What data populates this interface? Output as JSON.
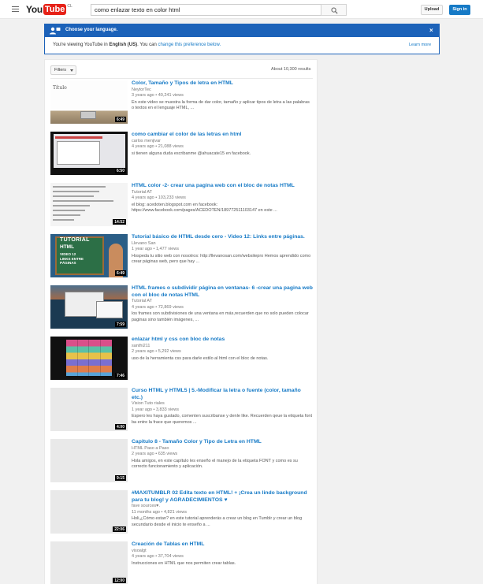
{
  "header": {
    "logo_you": "You",
    "logo_tube": "Tube",
    "logo_region": "CL",
    "search_value": "como enlazar texto en color html",
    "upload_label": "Upload",
    "signin_label": "Sign in"
  },
  "language_banner": {
    "title": "Choose your language.",
    "text_prefix": "You're viewing YouTube in ",
    "language": "English (US)",
    "text_middle": ". You can ",
    "change_link": "change this preference below.",
    "learn_more": "Learn more",
    "close": "×"
  },
  "results": {
    "filters_label": "Filters",
    "count_text": "About 10,300 results",
    "items": [
      {
        "title": "Color, Tamaño y Tipos de letra en HTML",
        "channel": "NeytorTec",
        "meta": "3 years ago  •  40,241 views",
        "description": "En este video se muestra la forma de dar color, tamaño y aplicar tipos de letra a las palabras o textos en el lenguaje HTML, ...",
        "duration": "6:49",
        "thumb_label": "Título"
      },
      {
        "title": "como cambiar el color de las letras en html",
        "channel": "carlos menjivar",
        "meta": "4 years ago  •  21,088 views",
        "description": "si tienen alguna duda escribanme @ahuacate15 en facebook.",
        "duration": "6:50"
      },
      {
        "title": "HTML color -2- crear una pagina web con el bloc de notas HTML",
        "channel": "Tutorial AT",
        "meta": "4 years ago  •  103,233 views",
        "description": "el blog: acedoten.blogspot.com en facebook: https://www.facebook.com/pages/ACEDOTEN/189772511103147 en este ...",
        "duration": "14:52"
      },
      {
        "title": "Tutorial básico de HTML desde cero - Video 12: Links entre páginas.",
        "channel": "Llevano San",
        "meta": "1 year ago  •  1,477 views",
        "description": "Hospeda tu sitio web con nosotros: http://llevanosan.com/websitepro Hemos aprendido como crear páginas web, pero que hay ...",
        "duration": "6:49",
        "thumb_line1": "TUTORIAL",
        "thumb_line2": "HTML",
        "thumb_line3": "VIDEO 12\nLINKS ENTRE\nPÁGINAS"
      },
      {
        "title": "HTML frames o subdividir página en ventanas- 6 -crear una pagina web con el bloc de notas HTML",
        "channel": "Tutorial AT",
        "meta": "4 years ago  •  72,869 views",
        "description": "los frames son subdivisiones de una ventana en más,recuerden que no solo pueden colocar paginas sino también imágenes, ...",
        "duration": "7:59"
      },
      {
        "title": "enlazar html y css con bloc de notas",
        "channel": "santhi211",
        "meta": "2 years ago  •  5,292 views",
        "description": "uso de la herramienta css para darle estilo al html con el bloc de notas.",
        "duration": "7:46"
      },
      {
        "title": "Curso HTML y HTML5 | 5.-Modificar la letra o fuente (color, tamaño etc.)",
        "channel": "Vision Tuto riales",
        "meta": "1 year ago  •  3,833 views",
        "description": "Espero les haya gustado, comenten suscribanse y denle like. Recuerden qeue la etiqueta font ba entre la frace que queremos ...",
        "duration": "4:00"
      },
      {
        "title": "Capitulo 8 - Tamaño Color y Tipo de Letra en HTML",
        "channel": "HTML Paso a Paso",
        "meta": "2 years ago  •  635 views",
        "description": "Hola amigos, en este capítulo les enseño el manejo de la etiqueta FONT y como es su correcto funcionamiento y aplicación.",
        "duration": "9:15"
      },
      {
        "title": "#MAXITUMBLR 02 Edita texto en HTML! + ¡Crea un lindo background para tu blog! y AGRADECIMIENTOS ♥",
        "channel": "fave sources♥.",
        "meta": "11 months ago  •  4,821 views",
        "description": "Holi,¿Cómo estan? en este tutorial aprenderás a crear un blog en Tumblr y crear un blog secundario desde el inicio te enseño a ...",
        "duration": "22:06"
      },
      {
        "title": "Creación de Tablas en HTML",
        "channel": "visoalgt",
        "meta": "4 years ago  •  37,704 views",
        "description": "Instrucciones en HTML que nos permiten crear tablas.",
        "duration": "12:00"
      }
    ]
  },
  "colors": {
    "accent_blue": "#167ac6",
    "banner_blue": "#1c62b9",
    "youtube_red": "#e62117"
  }
}
